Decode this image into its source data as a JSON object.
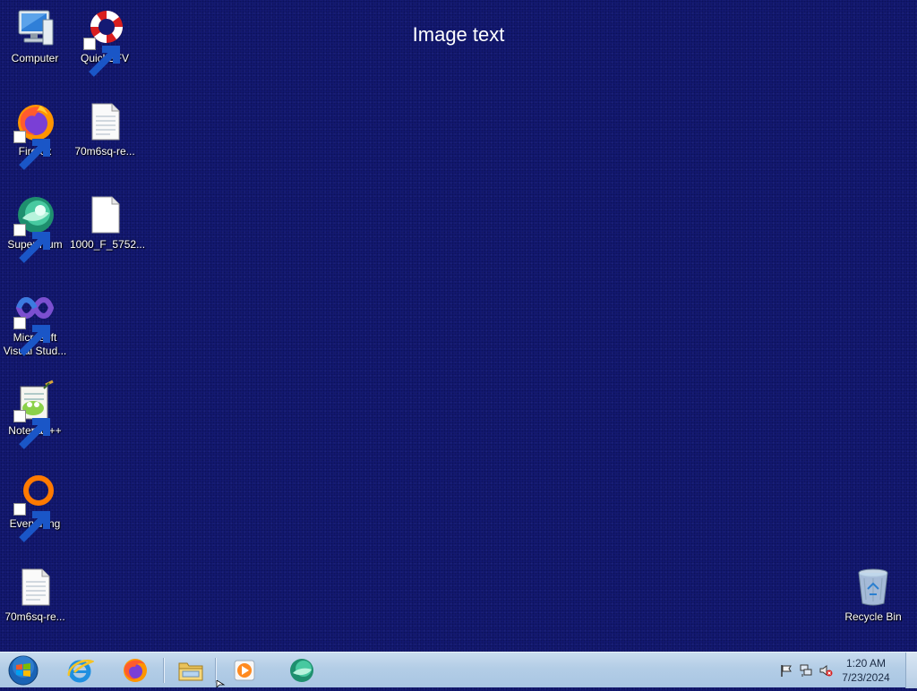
{
  "wallpaper": {
    "text": "Image text",
    "color": "#141a74"
  },
  "desktop_icons": [
    {
      "label": "Computer",
      "icon": "computer-icon"
    },
    {
      "label": "QuickSFV",
      "icon": "lifebuoy-icon"
    },
    {
      "label": "Firefox",
      "icon": "firefox-icon"
    },
    {
      "label": "70m6sq-re...",
      "icon": "text-file-icon"
    },
    {
      "label": "Supermium",
      "icon": "supermium-icon"
    },
    {
      "label": "1000_F_5752...",
      "icon": "blank-file-icon"
    },
    {
      "label": "Microsoft Visual Stud...",
      "icon": "visual-studio-icon"
    },
    {
      "label": "Notepad++",
      "icon": "notepadpp-icon"
    },
    {
      "label": "Everything",
      "icon": "everything-icon"
    },
    {
      "label": "70m6sq-re...",
      "icon": "text-file-icon"
    },
    {
      "label": "Recycle Bin",
      "icon": "recycle-bin-icon"
    }
  ],
  "taskbar": {
    "pinned": [
      {
        "name": "internet-explorer",
        "icon": "ie-icon"
      },
      {
        "name": "firefox",
        "icon": "firefox-icon"
      },
      {
        "name": "file-explorer",
        "icon": "folder-icon"
      },
      {
        "name": "media-player",
        "icon": "media-player-icon"
      },
      {
        "name": "supermium",
        "icon": "supermium-icon"
      }
    ],
    "tray_icons": [
      "flag-icon",
      "network-icon",
      "volume-muted-icon"
    ],
    "clock": {
      "time": "1:20 AM",
      "date": "7/23/2024"
    }
  }
}
